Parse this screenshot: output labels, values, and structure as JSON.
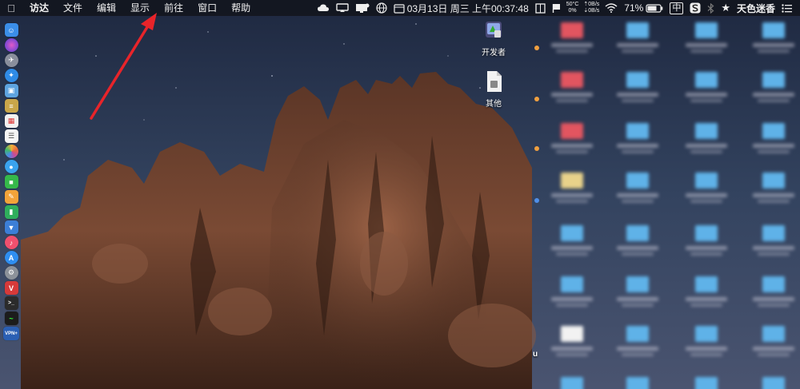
{
  "menubar": {
    "app_name": "访达",
    "items": [
      "文件",
      "编辑",
      "显示",
      "前往",
      "窗口",
      "帮助"
    ],
    "status": {
      "temperature": "50°C",
      "cpu": "0%",
      "net_up": "0B/s",
      "net_down": "0B/s",
      "datetime": "03月13日 周三 上午00:37:48",
      "battery": "71%",
      "input_method": "中",
      "user_name": "天色迷香"
    }
  },
  "desktop": {
    "icons": [
      {
        "label": "开发者",
        "icon": "developer-app-icon"
      },
      {
        "label": "其他",
        "icon": "document-file-icon"
      }
    ],
    "edge_label": "u"
  },
  "dock": {
    "items": [
      {
        "icon": "finder-icon",
        "color": "#3b8ee8"
      },
      {
        "icon": "siri-icon",
        "color": "#6b4fd6"
      },
      {
        "icon": "launchpad-icon",
        "color": "#8a8f9c"
      },
      {
        "icon": "safari-icon",
        "color": "#2f8be6"
      },
      {
        "icon": "preview-icon",
        "color": "#5ea4e0"
      },
      {
        "icon": "notes-icon",
        "color": "#c9a64a"
      },
      {
        "icon": "calendar-icon",
        "color": "#f1f1f1"
      },
      {
        "icon": "reminders-icon",
        "color": "#f5f5f5"
      },
      {
        "icon": "photos-icon",
        "color": "#e8683f"
      },
      {
        "icon": "messages-icon",
        "color": "#3aa3ee"
      },
      {
        "icon": "facetime-icon",
        "color": "#35b84a"
      },
      {
        "icon": "pages-icon",
        "color": "#f2a33a"
      },
      {
        "icon": "numbers-icon",
        "color": "#2fae5c"
      },
      {
        "icon": "keynote-icon",
        "color": "#3c7fd7"
      },
      {
        "icon": "music-icon",
        "color": "#f0506e"
      },
      {
        "icon": "app-store-icon",
        "color": "#2f8ef0"
      },
      {
        "icon": "system-preferences-icon",
        "color": "#8d929a"
      },
      {
        "icon": "vivaldi-icon",
        "color": "#d63a3a"
      },
      {
        "icon": "terminal-icon",
        "color": "#2b2b2b"
      },
      {
        "icon": "activity-monitor-icon",
        "color": "#1c1c1c"
      }
    ],
    "vpn_label": "VPN+"
  },
  "colors": {
    "annotation_arrow": "#e8242a",
    "sky": "#27334f",
    "rock": "#6b3f2c"
  }
}
